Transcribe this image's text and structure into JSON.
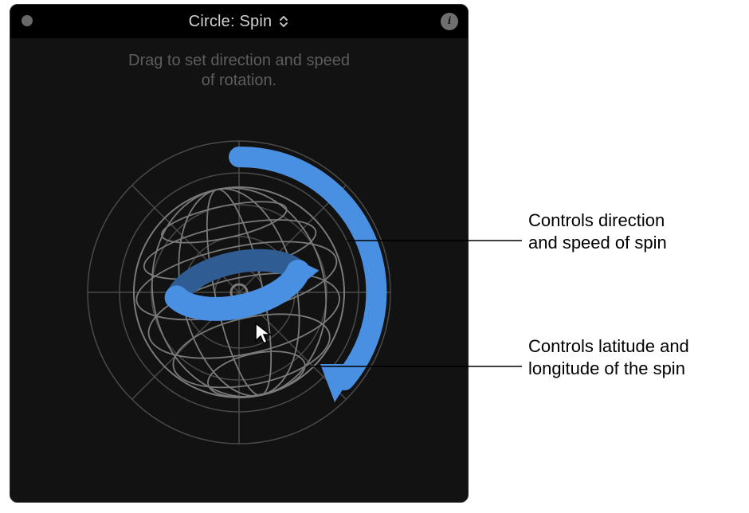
{
  "titlebar": {
    "title": "Circle: Spin"
  },
  "hint": {
    "line1": "Drag to set direction and speed",
    "line2": "of rotation."
  },
  "callouts": {
    "outer": {
      "line1": "Controls direction",
      "line2": "and speed of spin"
    },
    "inner": {
      "line1": "Controls latitude and",
      "line2": "longitude of the spin"
    }
  },
  "icons": {
    "info": "i"
  },
  "colors": {
    "accent": "#4a90e2",
    "accent_dark": "#2f5d93",
    "grid": "#4a4a4a",
    "sphere": "#6e6e6e"
  }
}
